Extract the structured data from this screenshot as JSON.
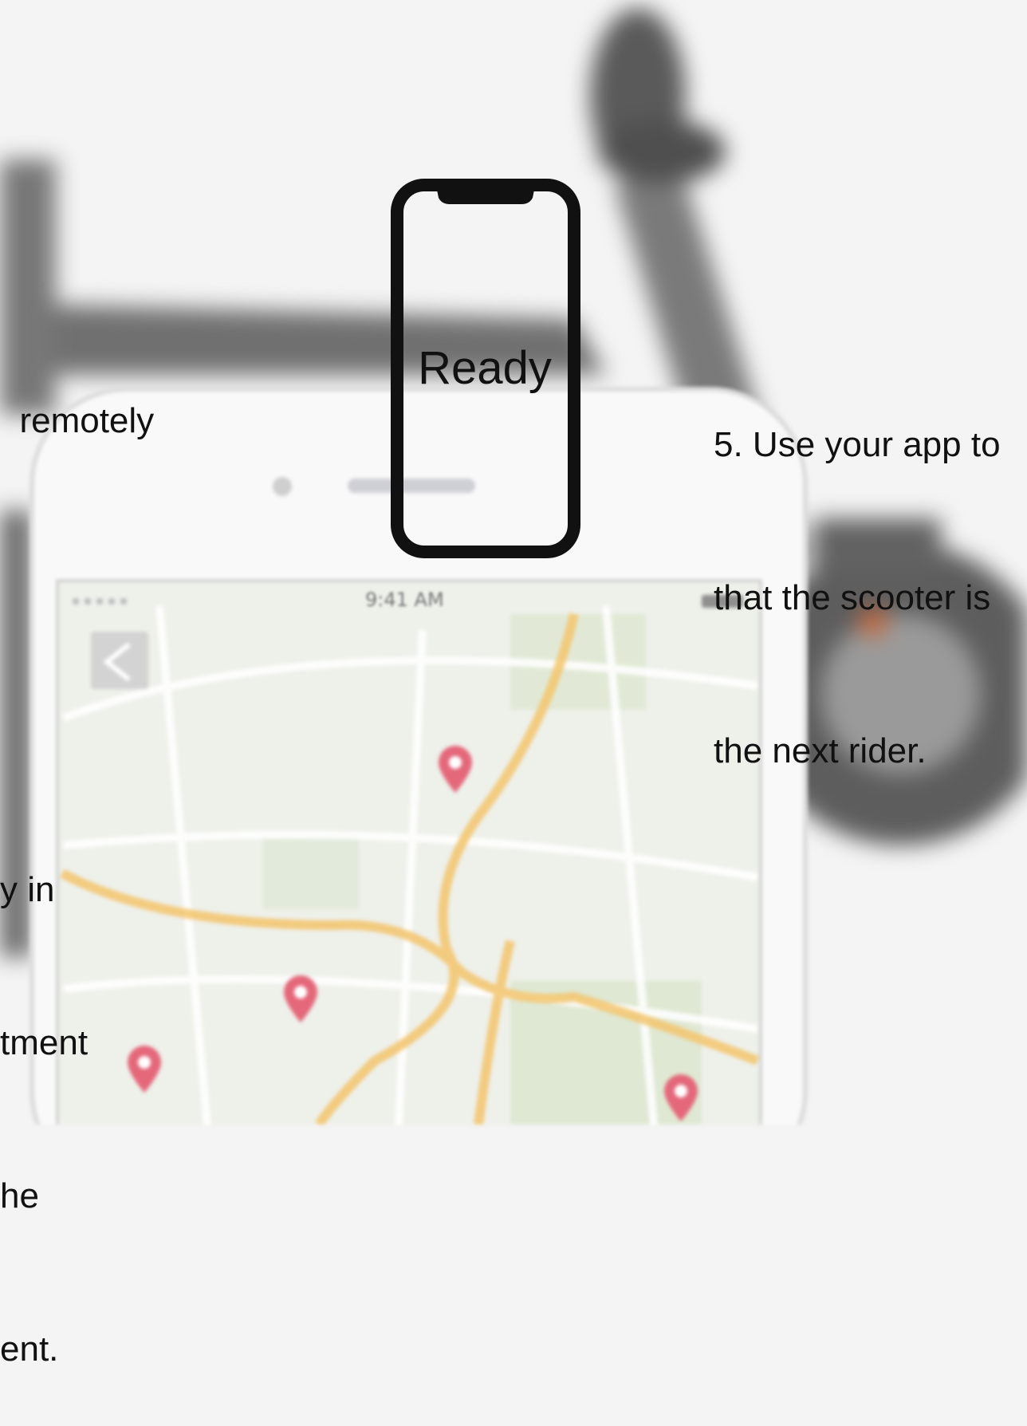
{
  "left_text_top": "remotely",
  "left_text_bottom": [
    "y in",
    "tment",
    "he",
    "ent."
  ],
  "right_text": [
    "5. Use your app to",
    "that the scooter is",
    "the next rider."
  ],
  "center_icon": {
    "name": "phone-outline-icon",
    "label": "Ready"
  },
  "phone_screen": {
    "status_time": "9:41 AM",
    "back_icon": "chevron-left-icon"
  },
  "colors": {
    "background": "#f4f4f4",
    "phone_outline": "#111111",
    "map_pin": "#e4687a",
    "map_road": "#f3c56d",
    "scooter": "#6a6a6a"
  }
}
